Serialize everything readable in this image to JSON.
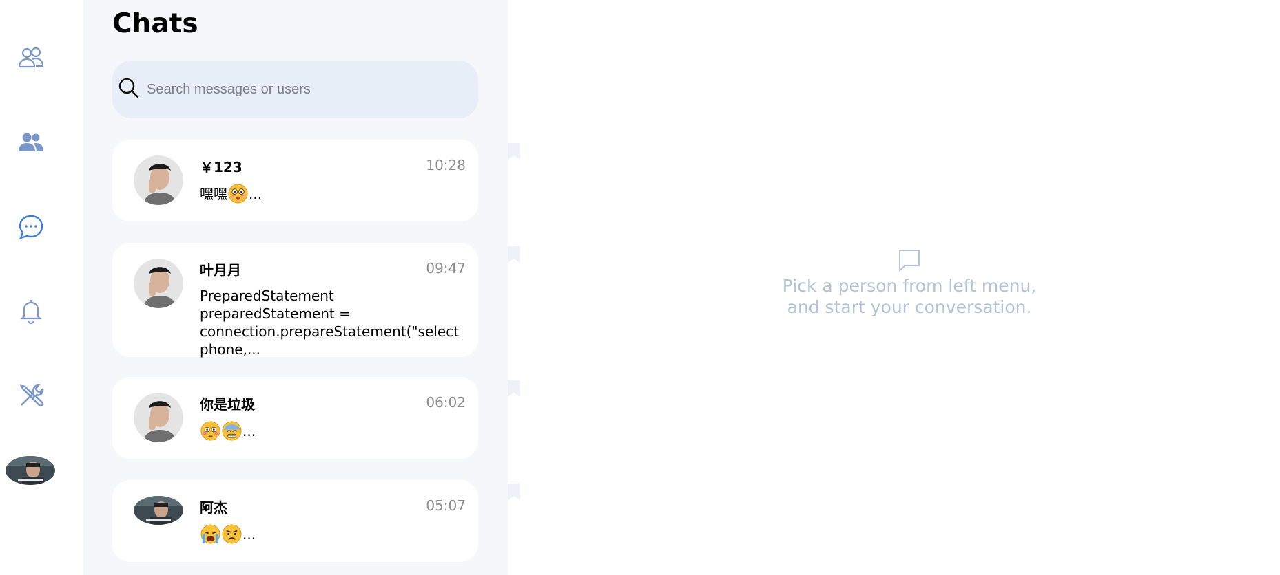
{
  "rail": {
    "items": [
      {
        "name": "contacts-icon"
      },
      {
        "name": "groups-icon"
      },
      {
        "name": "chats-icon"
      },
      {
        "name": "notifications-icon"
      },
      {
        "name": "settings-tools-icon"
      }
    ],
    "colors": {
      "inactive": "#7b97c7",
      "active": "#3b7ddd"
    }
  },
  "panel": {
    "title": "Chats",
    "search": {
      "placeholder": "Search messages or users",
      "value": ""
    }
  },
  "chats": [
    {
      "name": "￥123",
      "time": "10:28",
      "preview_text": "嘿嘿",
      "preview_emojis": [
        "dizzy-face-emoji"
      ],
      "preview_suffix": "..."
    },
    {
      "name": "叶月月",
      "time": "09:47",
      "preview_text": "PreparedStatement preparedStatement = connection.prepareStatement(\"select phone,...",
      "preview_emojis": [],
      "preview_suffix": ""
    },
    {
      "name": "你是垃圾",
      "time": "06:02",
      "preview_text": "",
      "preview_emojis": [
        "flushed-face-emoji",
        "cold-sweat-face-emoji"
      ],
      "preview_suffix": "..."
    },
    {
      "name": "阿杰",
      "time": "05:07",
      "preview_text": "",
      "preview_emojis": [
        "crying-face-emoji",
        "pouting-face-emoji"
      ],
      "preview_suffix": "..."
    }
  ],
  "empty_state": {
    "icon": "message-square-icon",
    "line1": "Pick a person from left menu,",
    "line2": "and start your conversation."
  }
}
